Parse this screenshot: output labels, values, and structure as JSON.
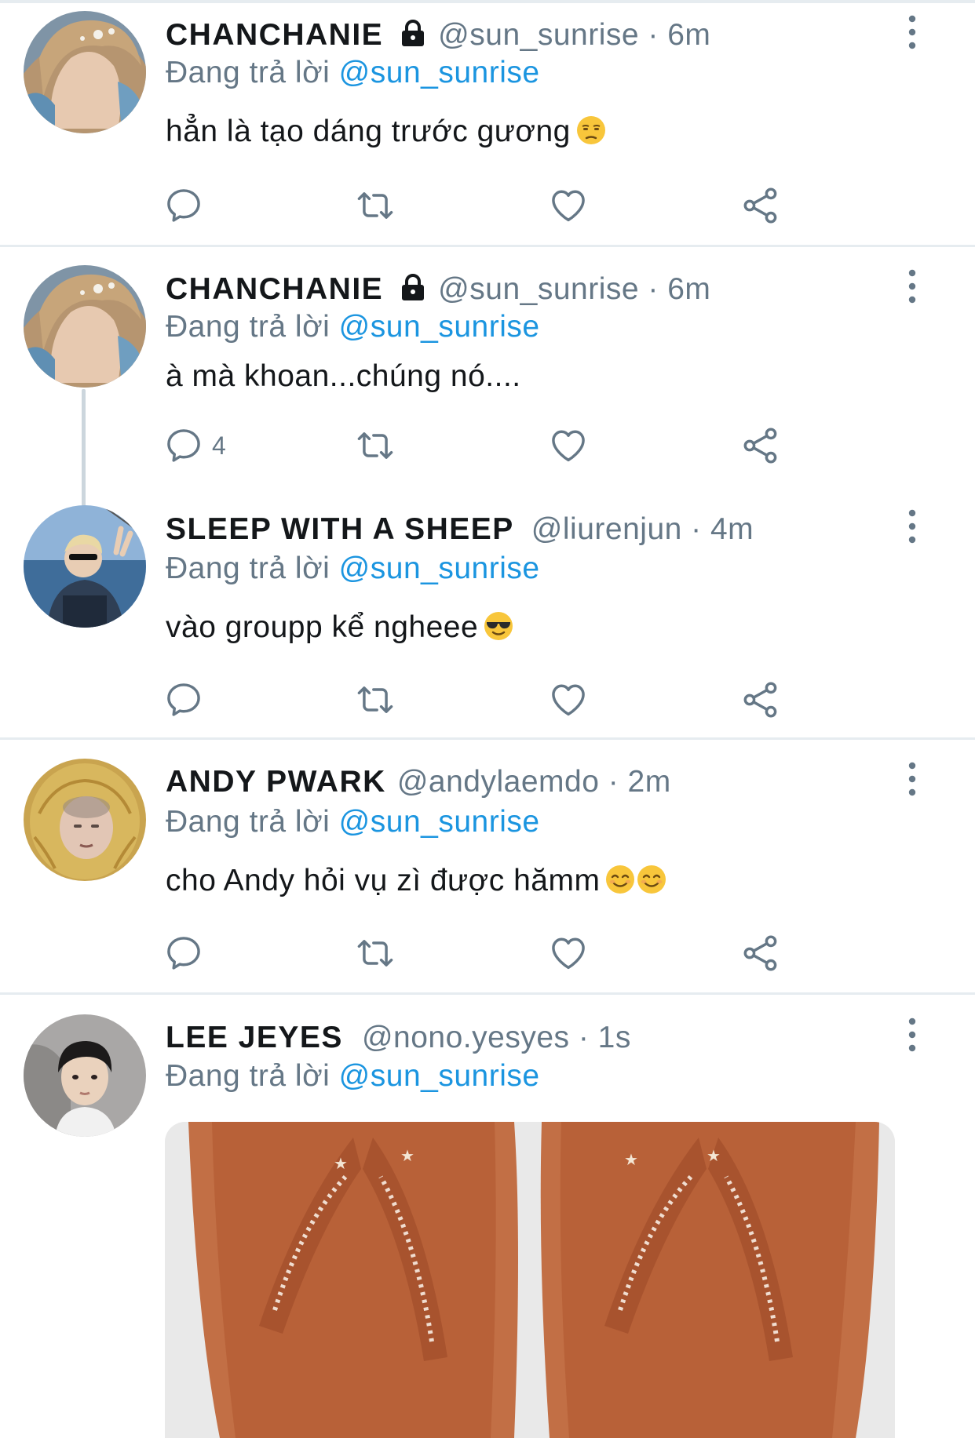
{
  "colors": {
    "accent": "#1b95e0",
    "secondary_text": "#657786",
    "divider": "#e6ecf0",
    "thread_line": "#ccd6dd"
  },
  "icons": {
    "reply": "reply-icon",
    "retweet": "retweet-icon",
    "like": "heart-icon",
    "share": "share-icon",
    "more": "more-vertical-icon",
    "lock": "lock-icon"
  },
  "tweets": [
    {
      "display_name": "CHANCHANIE",
      "meta": "@sun_sunrise · 6m",
      "reply_prefix": "Đang trả lời",
      "reply_handle": "@sun_sunrise",
      "text": "hẳn là tạo dáng trước gương",
      "emoji": "unamused-face"
    },
    {
      "display_name": "CHANCHANIE",
      "meta": "@sun_sunrise · 6m",
      "reply_prefix": "Đang trả lời",
      "reply_handle": "@sun_sunrise",
      "text": "à mà khoan...chúng nó....",
      "reply_count": "4"
    },
    {
      "display_name": "SLEEP WITH A SHEEP",
      "meta": "@liurenjun · 4m",
      "reply_prefix": "Đang trả lời",
      "reply_handle": "@sun_sunrise",
      "text": "vào groupp kể ngheee",
      "emoji": "sunglasses-face"
    },
    {
      "display_name": "ANDY PWARK",
      "meta": "@andylaemdo · 2m",
      "reply_prefix": "Đang trả lời",
      "reply_handle": "@sun_sunrise",
      "text": "cho Andy hỏi vụ zì được hămm",
      "emoji": "smiling-face x2"
    },
    {
      "display_name": "LEE JEYES",
      "meta": "@nono.yesyes · 1s",
      "reply_prefix": "Đang trả lời",
      "reply_handle": "@sun_sunrise",
      "media": "flip-flop-sandals-photo"
    }
  ]
}
